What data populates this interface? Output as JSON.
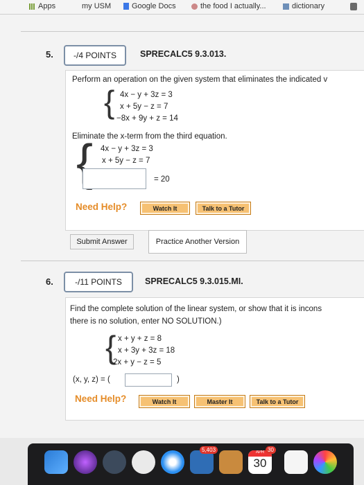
{
  "bookmarks": {
    "apps": "Apps",
    "my_usm": "my USM",
    "google_docs": "Google Docs",
    "food": "the food I actually...",
    "dictionary": "dictionary"
  },
  "q5": {
    "number": "5.",
    "points": "-/4 POINTS",
    "code": "SPRECALC5 9.3.013.",
    "prompt": "Perform an operation on the given system that eliminates the indicated v",
    "system": [
      "4x −   y + 3z =  3",
      "  x + 5y −   z =  7",
      "−8x + 9y +   z = 14"
    ],
    "instruction": "Eliminate the x-term from the third equation.",
    "result": [
      "4x − y + 3z = 3",
      "x + 5y − z = 7"
    ],
    "third_rhs": "= 20",
    "need_help": "Need Help?",
    "watch": "Watch It",
    "tutor": "Talk to a Tutor",
    "submit": "Submit Answer",
    "practice": "Practice Another Version"
  },
  "q6": {
    "number": "6.",
    "points": "-/11 POINTS",
    "code": "SPRECALC5 9.3.015.MI.",
    "prompt_line1": "Find the complete solution of the linear system, or show that it is incons",
    "prompt_line2": "there is no solution, enter NO SOLUTION.)",
    "system": [
      "x +   y +   z =   8",
      "x + 3y + 3z = 18",
      "2x +   y −   z =   5"
    ],
    "answer_label": "(x, y, z) = (",
    "answer_close": ")",
    "need_help": "Need Help?",
    "watch": "Watch It",
    "master": "Master It",
    "tutor": "Talk to a Tutor"
  },
  "dock": {
    "badge": "5,403",
    "calendar_month": "APR",
    "calendar_badge": "30",
    "calendar_day": "30"
  }
}
